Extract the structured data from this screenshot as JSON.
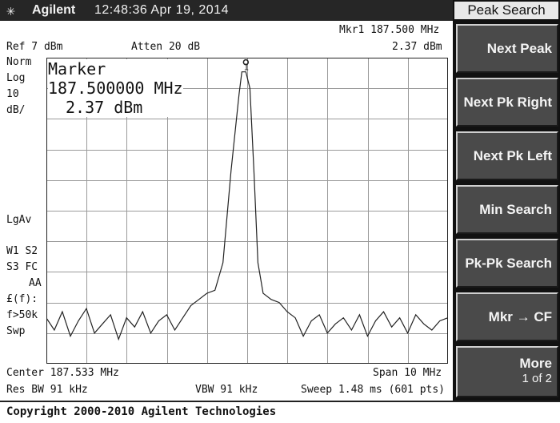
{
  "title_bar": {
    "brand": "Agilent",
    "timestamp": "12:48:36  Apr 19, 2014"
  },
  "header": {
    "marker_readout": "Mkr1  187.500 MHz",
    "marker_value": "2.37 dBm",
    "ref_level": "Ref 7 dBm",
    "attenuation": "Atten 20 dB"
  },
  "left_annotations": {
    "norm": "Norm",
    "log": "Log",
    "scale_value": "10",
    "scale_unit": "dB/",
    "lgav": "LgAv",
    "w1s2": "W1  S2",
    "s3fc": "S3  FC",
    "aa": "AA",
    "ff": "£(f):",
    "f50k": "f>50k",
    "swp": "Swp"
  },
  "marker_box": {
    "label": "Marker",
    "frequency": "187.500000 MHz",
    "amplitude": "2.37 dBm",
    "marker_number": "1"
  },
  "footer": {
    "center": "Center 187.533 MHz",
    "span": "Span 10 MHz",
    "res_bw": "Res BW 91 kHz",
    "vbw": "VBW 91 kHz",
    "sweep": "Sweep 1.48 ms (601 pts)"
  },
  "softkeys": {
    "menu_title": "Peak Search",
    "keys": [
      {
        "line1": "Next Peak",
        "line2": ""
      },
      {
        "line1": "Next Pk Right",
        "line2": ""
      },
      {
        "line1": "Next Pk Left",
        "line2": ""
      },
      {
        "line1": "Min Search",
        "line2": ""
      },
      {
        "line1": "Pk-Pk Search",
        "line2": ""
      },
      {
        "line1": "Mkr → CF",
        "line2": ""
      },
      {
        "line1": "More",
        "line2": "1 of 2"
      }
    ]
  },
  "copyright": "Copyright 2000-2010 Agilent Technologies",
  "chart_data": {
    "type": "line",
    "x_unit": "MHz",
    "y_unit": "dBm",
    "xlim": [
      182.533,
      192.533
    ],
    "ylim": [
      -93,
      7
    ],
    "grid": true,
    "series": [
      {
        "x": [
          182.53,
          182.73,
          182.93,
          183.13,
          183.33,
          183.53,
          183.73,
          183.93,
          184.13,
          184.33,
          184.53,
          184.73,
          184.93,
          185.13,
          185.33,
          185.53,
          185.73,
          185.93,
          186.13,
          186.33,
          186.53,
          186.73,
          186.93,
          187.13,
          187.33,
          187.4,
          187.5,
          187.6,
          187.7,
          187.8,
          187.93,
          188.13,
          188.33,
          188.53,
          188.73,
          188.93,
          189.13,
          189.33,
          189.53,
          189.73,
          189.93,
          190.13,
          190.33,
          190.53,
          190.73,
          190.93,
          191.13,
          191.33,
          191.53,
          191.73,
          191.93,
          192.13,
          192.33,
          192.53
        ],
        "y": [
          -78,
          -82,
          -76,
          -84,
          -79,
          -75,
          -83,
          -80,
          -77,
          -85,
          -78,
          -81,
          -76,
          -83,
          -79,
          -77,
          -82,
          -78,
          -74,
          -72,
          -70,
          -69,
          -60,
          -30,
          -5,
          2.37,
          2.37,
          -3,
          -30,
          -60,
          -70,
          -72,
          -73,
          -76,
          -78,
          -84,
          -79,
          -77,
          -83,
          -80,
          -78,
          -82,
          -77,
          -84,
          -79,
          -76,
          -81,
          -78,
          -83,
          -77,
          -80,
          -82,
          -79,
          -78
        ]
      }
    ],
    "markers": [
      {
        "id": "1",
        "x": 187.5,
        "y": 2.37
      }
    ]
  }
}
